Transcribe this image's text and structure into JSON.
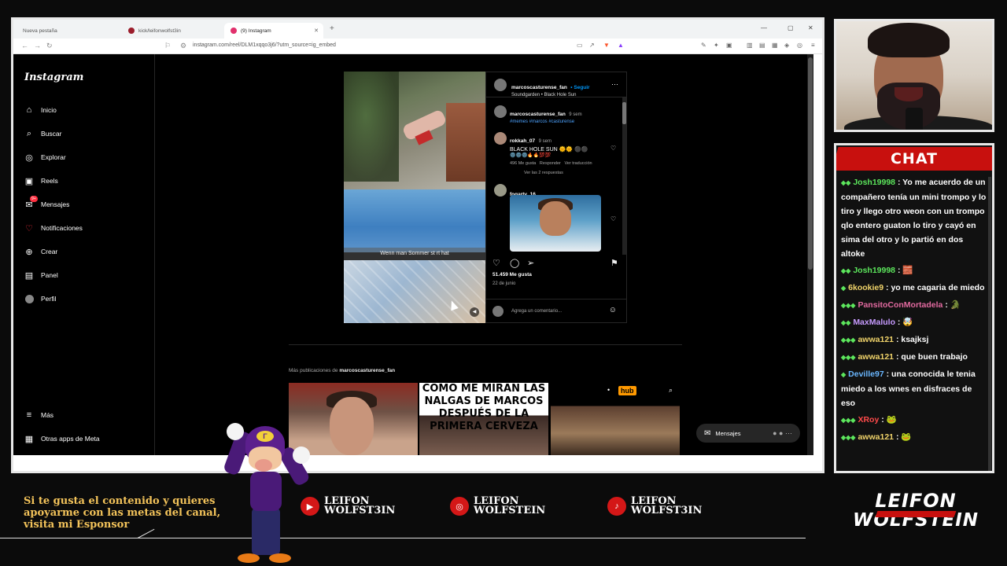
{
  "browser": {
    "tabs": [
      {
        "label": "Nueva pestaña"
      },
      {
        "label": "kick/leifonwolfst3in"
      },
      {
        "label": "(9) Instagram"
      }
    ],
    "url": "instagram.com/reel/DLM1xqqo3j6/?utm_source=ig_embed"
  },
  "instagram": {
    "logo": "Instagram",
    "nav": [
      {
        "label": "Inicio",
        "icon": "home-icon"
      },
      {
        "label": "Buscar",
        "icon": "search-icon"
      },
      {
        "label": "Explorar",
        "icon": "compass-icon"
      },
      {
        "label": "Reels",
        "icon": "reels-icon"
      },
      {
        "label": "Mensajes",
        "icon": "messenger-icon",
        "badge": "9+"
      },
      {
        "label": "Notificaciones",
        "icon": "heart-icon"
      },
      {
        "label": "Crear",
        "icon": "plus-square-icon"
      },
      {
        "label": "Panel",
        "icon": "panel-icon"
      },
      {
        "label": "Perfil",
        "icon": "profile-avatar-icon"
      }
    ],
    "nav_bottom": [
      {
        "label": "Más",
        "icon": "menu-icon"
      },
      {
        "label": "Otras apps de Meta",
        "icon": "meta-apps-icon"
      }
    ],
    "post": {
      "author": "marcoscasturense_fan",
      "follow": "• Seguir",
      "audio": "Soundgarden • Black Hole Sun",
      "video_caption": "Wenn man Sommer st   rt hat",
      "caption_user": "marcoscasturense_fan",
      "caption_time": "9 sem",
      "caption_tags": "#memes #marcos #casturense",
      "comment1_user": "rokkah_07",
      "comment1_time": "9 sem",
      "comment1_text": "BLACK HOLE SUN 🌞🌞 ⚫⚫",
      "comment1_emojis": "🌚🌚🌚🔥🔥💯💯",
      "comment1_likes": "496 Me gusta",
      "comment1_reply": "Responder",
      "comment1_translate": "Ver traducción",
      "replies": "Ver las 2 respuestas",
      "comment2_user": "fogarty_16_",
      "likes": "51.459 Me gusta",
      "date": "22 de junio",
      "add_comment": "Agrega un comentario..."
    },
    "more": {
      "prefix": "Más publicaciones de",
      "user": "marcoscasturense_fan",
      "meme_lines": [
        "COMO ME MIRAN LAS",
        "NALGAS DE MARCOS",
        "DESPUÉS DE LA",
        "PRIMERA CERVEZA"
      ],
      "hub": "hub"
    },
    "messages_pill": "Mensajes"
  },
  "chat": {
    "title": "CHAT",
    "messages": [
      {
        "user": "Josh19998",
        "color": "#5ce65c",
        "text": ": Yo me acuerdo de un compañero tenía un mini trompo y lo tiro y llego otro weon con un trompo qlo entero guaton lo tiro y cayó en sima del otro y lo partió en dos altoke"
      },
      {
        "user": "Josh19998",
        "color": "#5ce65c",
        "text": ": 🧱"
      },
      {
        "user": "6kookie9",
        "color": "#f0d36a",
        "text": ": yo me cagaria de miedo"
      },
      {
        "user": "PansitoConMortadela",
        "color": "#e36aa0",
        "text": ": 🐊"
      },
      {
        "user": "MaxMalulo",
        "color": "#c79bff",
        "text": ": 🤯"
      },
      {
        "user": "awwa121",
        "color": "#f0d36a",
        "text": ": ksajksj"
      },
      {
        "user": "awwa121",
        "color": "#f0d36a",
        "text": ": que buen trabajo"
      },
      {
        "user": "Deville97",
        "color": "#6ab7ff",
        "text": ": una conocida le tenia miedo a los wnes en disfraces de eso"
      },
      {
        "user": "XRoy",
        "color": "#ff4a4a",
        "text": ": 🐸"
      },
      {
        "user": "awwa121",
        "color": "#f0d36a",
        "text": ": 🐸"
      }
    ]
  },
  "banner": {
    "support_text": [
      "Si te gusta el contenido y quieres",
      "apoyarme con las metas del canal,",
      "visita mi Esponsor"
    ],
    "socials": [
      {
        "platform": "youtube-icon",
        "line1": "LEIFON",
        "line2": "WOLFST3IN"
      },
      {
        "platform": "instagram-icon",
        "line1": "LEIFON",
        "line2": "WOLFSTEIN"
      },
      {
        "platform": "tiktok-icon",
        "line1": "LEIFON",
        "line2": "WOLFST3IN"
      }
    ],
    "brand_line1": "LEIFON",
    "brand_line2": "WOLFSTEIN"
  }
}
